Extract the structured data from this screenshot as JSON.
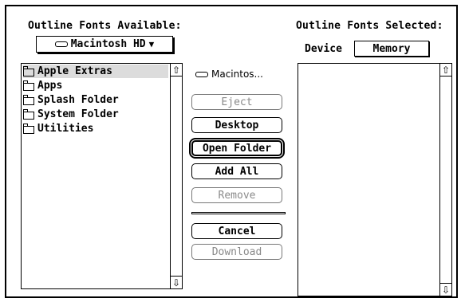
{
  "available": {
    "title": "Outline Fonts Available:",
    "popup_label": "Macintosh HD",
    "popup_icon": "disk-icon",
    "items": [
      {
        "label": "Apple Extras",
        "selected": true,
        "icon": "folder-icon"
      },
      {
        "label": "Apps",
        "selected": false,
        "icon": "folder-icon"
      },
      {
        "label": "Splash Folder",
        "selected": false,
        "icon": "folder-icon"
      },
      {
        "label": "System Folder",
        "selected": false,
        "icon": "folder-icon"
      },
      {
        "label": "Utilities",
        "selected": false,
        "icon": "folder-icon"
      }
    ]
  },
  "middle": {
    "disk_name": "Macintos...",
    "buttons": {
      "eject": {
        "label": "Eject",
        "enabled": false
      },
      "desktop": {
        "label": "Desktop",
        "enabled": true
      },
      "open_folder": {
        "label": "Open Folder",
        "enabled": true,
        "default": true
      },
      "add_all": {
        "label": "Add All",
        "enabled": true
      },
      "remove": {
        "label": "Remove",
        "enabled": false
      },
      "cancel": {
        "label": "Cancel",
        "enabled": true
      },
      "download": {
        "label": "Download",
        "enabled": false
      }
    }
  },
  "selected": {
    "title": "Outline Fonts Selected:",
    "device_label": "Device",
    "device_value": "Memory",
    "items": []
  },
  "colors": {
    "selection": "#dcdcdc",
    "disabled_text": "#8a8a8a"
  }
}
